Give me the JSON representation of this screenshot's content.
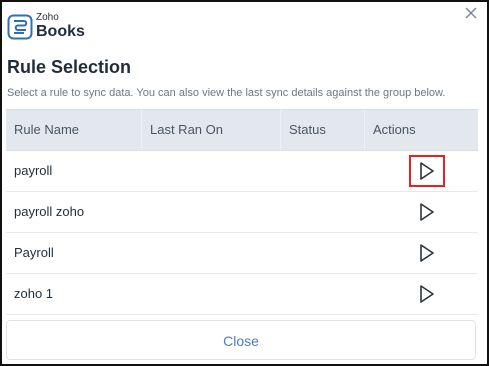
{
  "brand": {
    "line1": "Zoho",
    "line2": "Books"
  },
  "dialog": {
    "title": "Rule Selection",
    "description": "Select a rule to sync data. You can also view the last sync details against the group below.",
    "close_label": "Close"
  },
  "table": {
    "headers": [
      "Rule Name",
      "Last Ran On",
      "Status",
      "Actions"
    ],
    "rows": [
      {
        "name": "payroll",
        "last_ran": "",
        "status": "",
        "action_icon": "play-icon"
      },
      {
        "name": "payroll zoho",
        "last_ran": "",
        "status": "",
        "action_icon": "play-icon"
      },
      {
        "name": "Payroll",
        "last_ran": "",
        "status": "",
        "action_icon": "play-icon"
      },
      {
        "name": "zoho 1",
        "last_ran": "",
        "status": "",
        "action_icon": "play-icon"
      }
    ]
  },
  "colors": {
    "highlight": "#e02424",
    "link": "#4a7bc4",
    "header_bg": "#e3e8ee"
  }
}
